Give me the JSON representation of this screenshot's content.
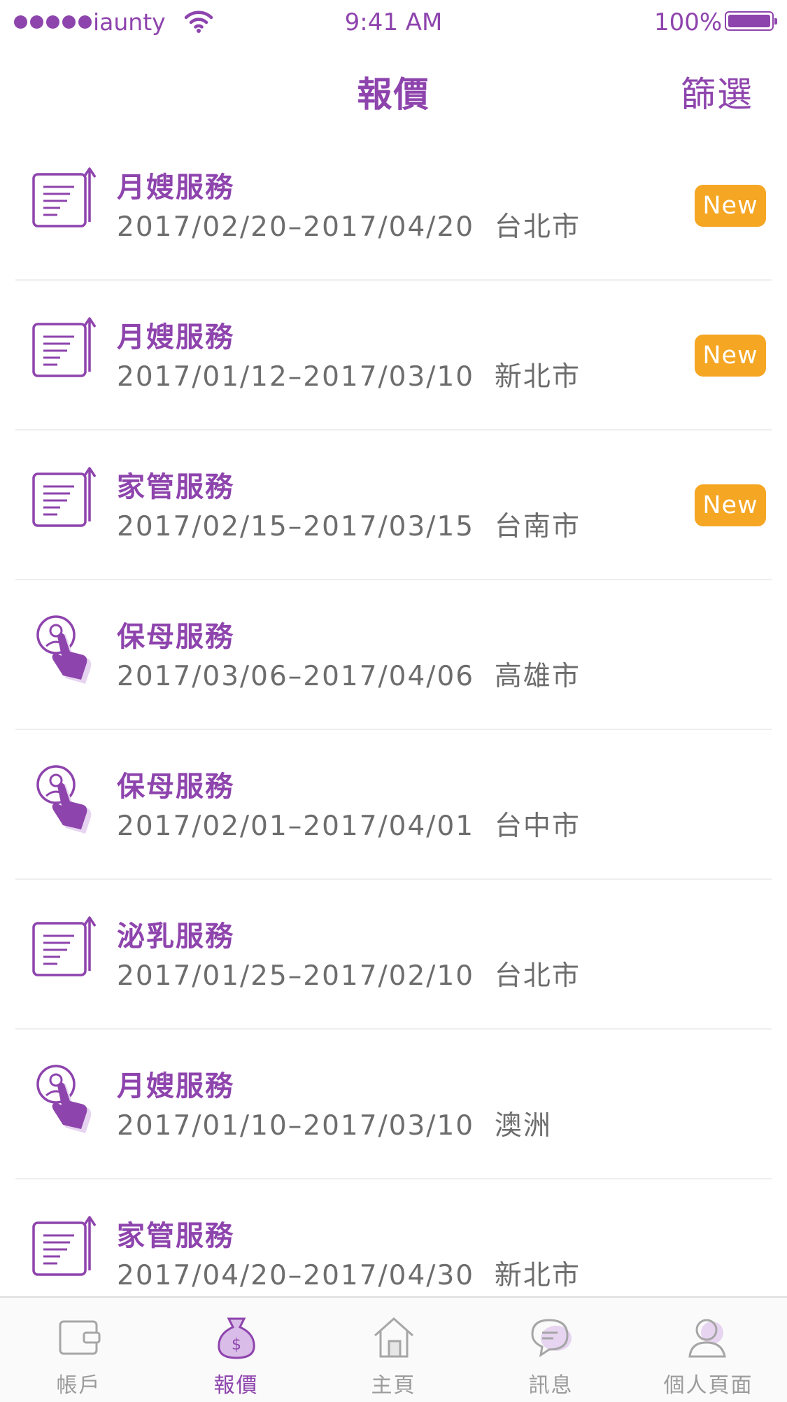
{
  "status_bar": {
    "carrier": "iaunty",
    "time": "9:41 AM",
    "battery": "100%"
  },
  "nav": {
    "title": "報價",
    "filter_label": "篩選"
  },
  "quotes": [
    {
      "title": "月嫂服務",
      "dates": "2017/02/20–2017/04/20",
      "city": "台北市",
      "icon": "document-upload-icon",
      "badge": "New"
    },
    {
      "title": "月嫂服務",
      "dates": "2017/01/12–2017/03/10",
      "city": "新北市",
      "icon": "document-upload-icon",
      "badge": "New"
    },
    {
      "title": "家管服務",
      "dates": "2017/02/15–2017/03/15",
      "city": "台南市",
      "icon": "document-upload-icon",
      "badge": "New"
    },
    {
      "title": "保母服務",
      "dates": "2017/03/06–2017/04/06",
      "city": "高雄市",
      "icon": "user-tap-icon",
      "badge": ""
    },
    {
      "title": "保母服務",
      "dates": "2017/02/01–2017/04/01",
      "city": "台中市",
      "icon": "user-tap-icon",
      "badge": ""
    },
    {
      "title": "泌乳服務",
      "dates": "2017/01/25–2017/02/10",
      "city": "台北市",
      "icon": "document-upload-icon",
      "badge": ""
    },
    {
      "title": "月嫂服務",
      "dates": "2017/01/10–2017/03/10",
      "city": "澳洲",
      "icon": "user-tap-icon",
      "badge": ""
    },
    {
      "title": "家管服務",
      "dates": "2017/04/20–2017/04/30",
      "city": "新北市",
      "icon": "document-upload-icon",
      "badge": ""
    }
  ],
  "tabs": [
    {
      "label": "帳戶",
      "icon": "wallet-icon",
      "active": false
    },
    {
      "label": "報價",
      "icon": "money-bag-icon",
      "active": true
    },
    {
      "label": "主頁",
      "icon": "home-icon",
      "active": false
    },
    {
      "label": "訊息",
      "icon": "chat-bubble-icon",
      "active": false
    },
    {
      "label": "個人頁面",
      "icon": "person-icon",
      "active": false
    }
  ],
  "colors": {
    "accent": "#8e44ad",
    "badge": "#f5a623",
    "subtext": "#6d6d6d",
    "tab_inactive": "#9b9b9b"
  }
}
